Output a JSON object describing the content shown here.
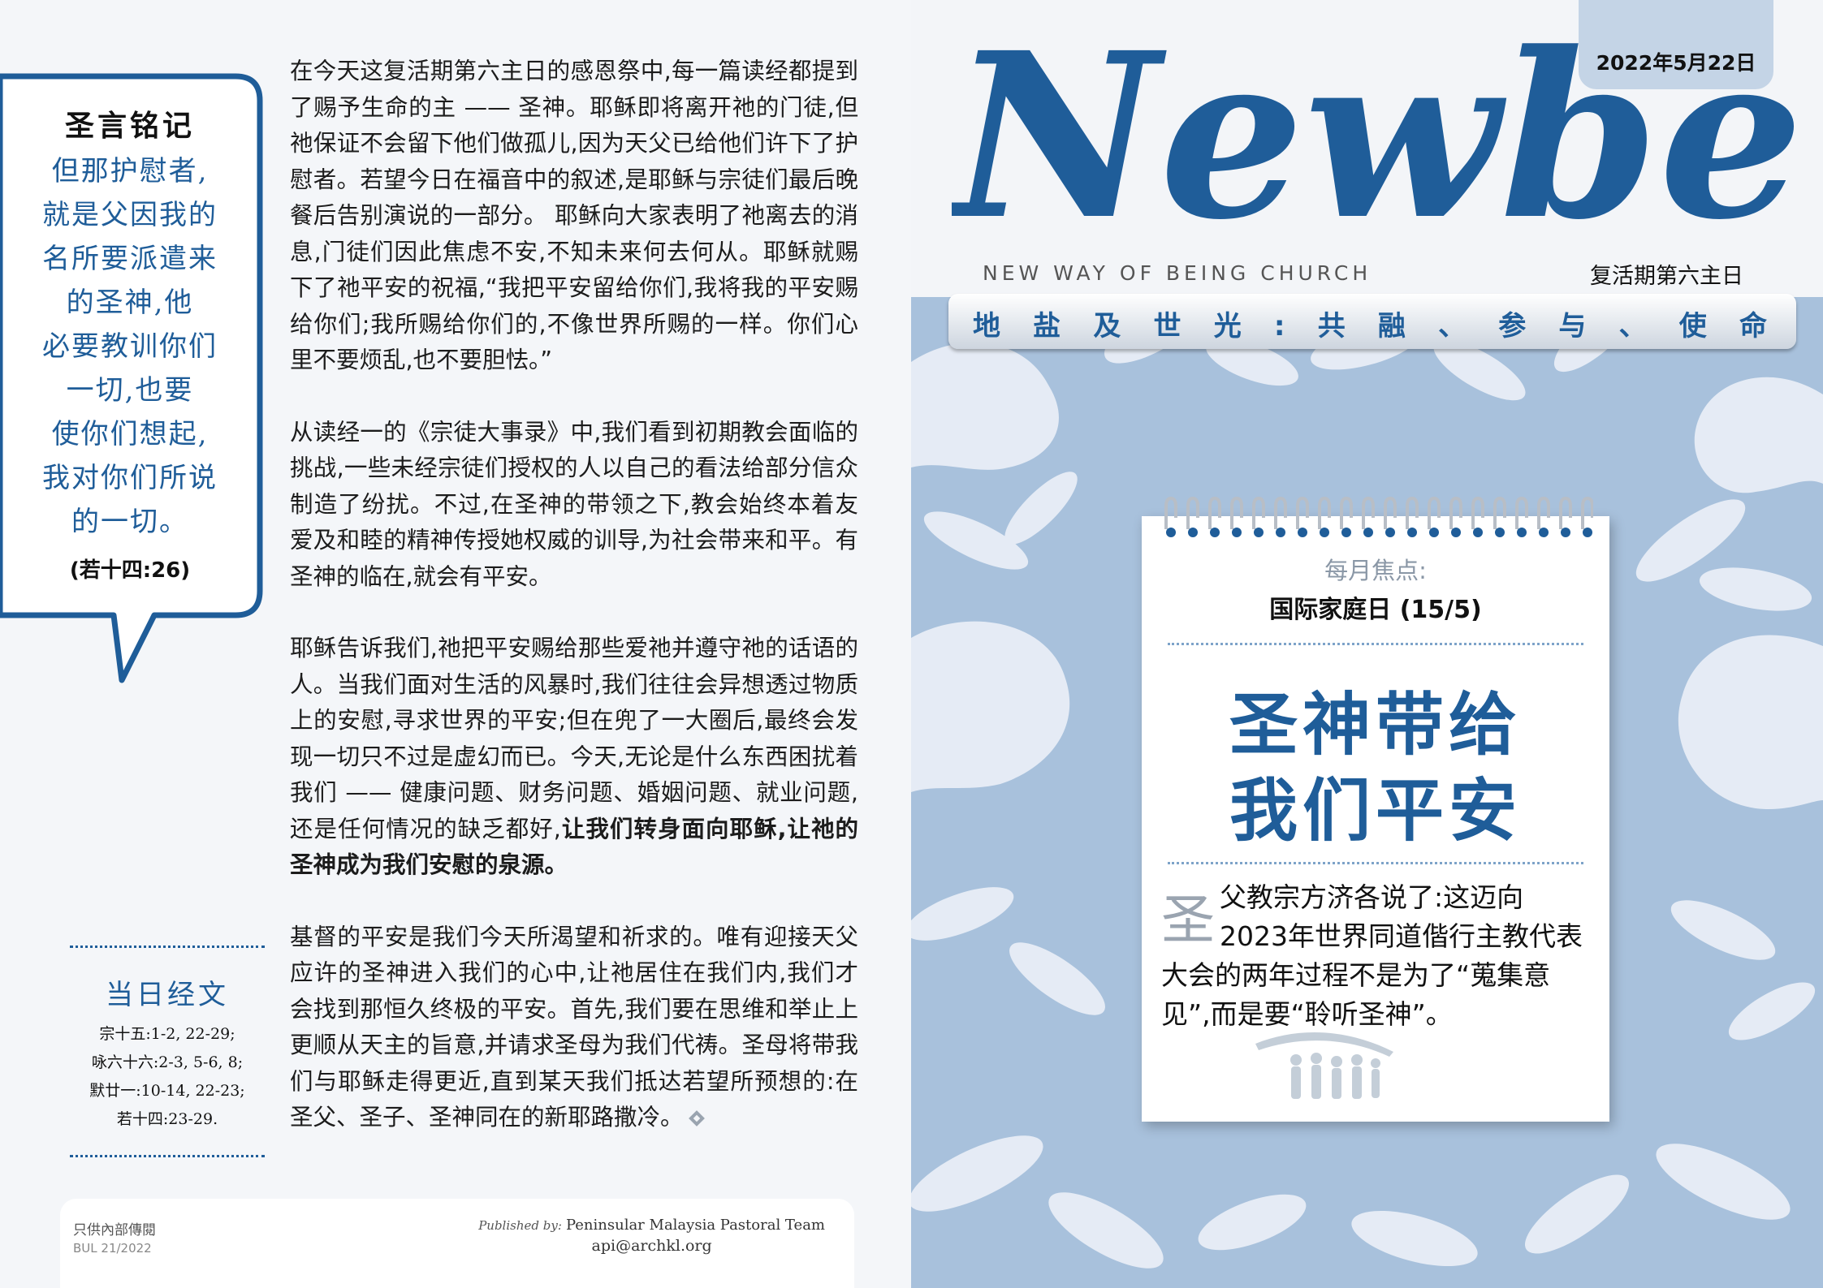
{
  "left": {
    "quote": {
      "title": "圣言铭记",
      "lines": [
        "但那护慰者,",
        "就是父因我的",
        "名所要派遣来",
        "的圣神,他",
        "必要教训你们",
        "一切,也要",
        "使你们想起,",
        "我对你们所说",
        "的一切。"
      ],
      "reference": "(若十四:26)"
    },
    "paragraphs": {
      "p1": "在今天这复活期第六主日的感恩祭中,每一篇读经都提到了赐予生命的主 —— 圣神。耶稣即将离开祂的门徒,但祂保证不会留下他们做孤儿,因为天父已给他们许下了护慰者。若望今日在福音中的叙述,是耶稣与宗徒们最后晚餐后告别演说的一部分。 耶稣向大家表明了祂离去的消息,门徒们因此焦虑不安,不知未来何去何从。耶稣就赐下了祂平安的祝福,“我把平安留给你们,我将我的平安赐给你们;我所赐给你们的,不像世界所赐的一样。你们心里不要烦乱,也不要胆怯。”",
      "p2": "从读经一的《宗徒大事录》中,我们看到初期教会面临的挑战,一些未经宗徒们授权的人以自己的看法给部分信众制造了纷扰。不过,在圣神的带领之下,教会始终本着友爱及和睦的精神传授她权威的训导,为社会带来和平。有圣神的临在,就会有平安。",
      "p3_plain": "耶稣告诉我们,祂把平安赐给那些爱祂并遵守祂的话语的人。当我们面对生活的风暴时,我们往往会异想透过物质上的安慰,寻求世界的平安;但在兜了一大圈后,最终会发现一切只不过是虚幻而已。今天,无论是什么东西困扰着我们 —— 健康问题、财务问题、婚姻问题、就业问题,还是任何情况的缺乏都好,",
      "p3_bold": "让我们转身面向耶稣,让祂的圣神成为我们安慰的泉源。",
      "p4": "基督的平安是我们今天所渴望和祈求的。唯有迎接天父应许的圣神进入我们的心中,让祂居住在我们内,我们才会找到那恒久终极的平安。首先,我们要在思维和举止上更顺从天主的旨意,并请求圣母为我们代祷。圣母将带我们与耶稣走得更近,直到某天我们抵达若望所预想的:在圣父、圣子、圣神同在的新耶路撒冷。"
    },
    "readings": {
      "title": "当日经文",
      "items": [
        "宗十五:1-2, 22-29;",
        "咏六十六:2-3, 5-6, 8;",
        "默廿一:10-14, 22-23;",
        "若十四:23-29."
      ]
    },
    "footer": {
      "internal_note": "只供內部傳閱",
      "bulletin_no": "BUL 21/2022",
      "published_label": "Published by:",
      "publisher": "Peninsular Malaysia Pastoral Team",
      "email": "api@archkl.org"
    }
  },
  "right": {
    "date": "2022年5月22日",
    "logo_text": "Newbec",
    "tagline": "NEW WAY OF BEING CHURCH",
    "sunday": "复活期第六主日",
    "theme": "地盐及世光:共融、参与、使命",
    "focus_label": "每月焦点:",
    "focus_event": "国际家庭日 (15/5)",
    "headline_1": "圣神带给",
    "headline_2": "我们平安",
    "drop_cap": "圣",
    "body": "父教宗方济各说了:这迈向2023年世界同道偕行主教代表大会的两年过程不是为了“蒐集意见”,而是要“聆听圣神”。"
  },
  "colors": {
    "brand_blue": "#1f5d99",
    "background_blue": "#a8c1dc",
    "tab_blue": "#c4d4e6"
  }
}
